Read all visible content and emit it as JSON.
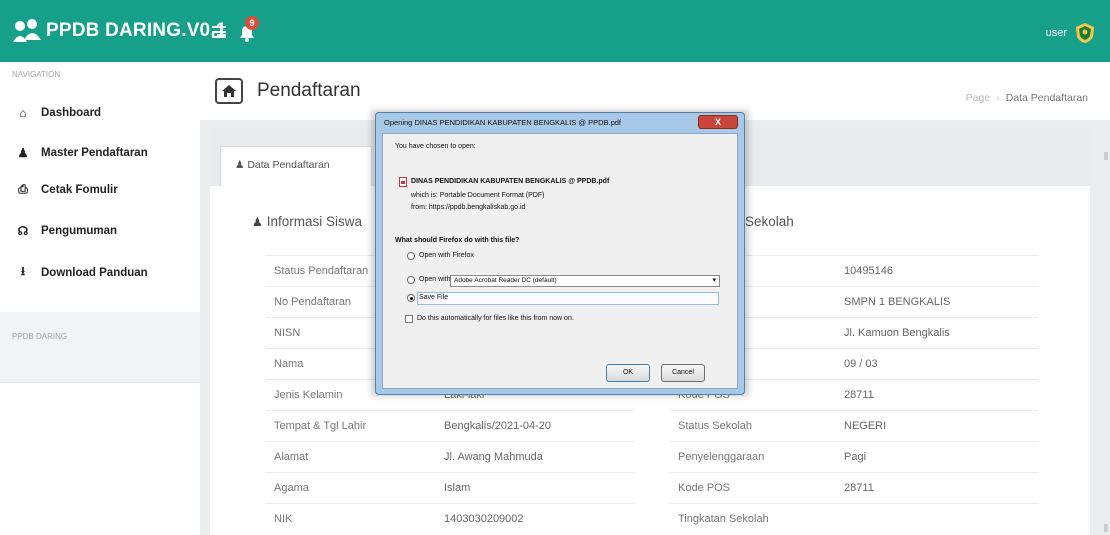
{
  "topbar": {
    "app_title": "PPDB DARING.V0.1",
    "notification_count": "9",
    "username": "user",
    "accent_color": "#16a08a"
  },
  "sidebar": {
    "nav_header": "NAVIGATION",
    "items": [
      {
        "label": "Dashboard",
        "icon": "home-icon"
      },
      {
        "label": "Master Pendaftaran",
        "icon": "user-icon"
      },
      {
        "label": "Cetak Fomulir",
        "icon": "print-icon"
      },
      {
        "label": "Pengumuman",
        "icon": "bullhorn-icon"
      },
      {
        "label": "Download Panduan",
        "icon": "download-icon"
      }
    ],
    "section_label": "PPDB DARING"
  },
  "header": {
    "title": "Pendaftaran",
    "breadcrumb": [
      "Page",
      "Data Pendaftaran"
    ]
  },
  "tabs": {
    "active": "Data Pendaftaran"
  },
  "siswa": {
    "title": "Informasi Siswa",
    "rows": [
      {
        "label": "Status Pendaftaran",
        "value": ""
      },
      {
        "label": "No Pendaftaran",
        "value": ""
      },
      {
        "label": "NISN",
        "value": ""
      },
      {
        "label": "Nama",
        "value": ""
      },
      {
        "label": "Jenis Kelamin",
        "value": "Laki-laki"
      },
      {
        "label": "Tempat & Tgl Lahir",
        "value": "Bengkalis/2021-04-20"
      },
      {
        "label": "Alamat",
        "value": "Jl. Awang Mahmuda"
      },
      {
        "label": "Agama",
        "value": "Islam"
      },
      {
        "label": "NIK",
        "value": "1403030209002"
      }
    ]
  },
  "sekolah": {
    "title": "Sekolah",
    "rows": [
      {
        "label": "",
        "value": "10495146"
      },
      {
        "label": "",
        "value": "SMPN 1 BENGKALIS"
      },
      {
        "label": "",
        "value": "Jl. Kamuon Bengkalis"
      },
      {
        "label": "",
        "value": "09 / 03"
      },
      {
        "label": "Kode POS",
        "value": "28711"
      },
      {
        "label": "Status Sekolah",
        "value": "NEGERI"
      },
      {
        "label": "Penyelenggaraan",
        "value": "Pagi"
      },
      {
        "label": "Kode POS",
        "value": "28711"
      },
      {
        "label": "Tingkatan Sekolah",
        "value": ""
      }
    ]
  },
  "dialog": {
    "title": "Opening DINAS PENDIDIKAN KABUPATEN BENGKALIS @ PPDB.pdf",
    "close_label": "X",
    "chosen_text": "You have chosen to open:",
    "file_name": "DINAS PENDIDIKAN KABUPATEN BENGKALIS @ PPDB.pdf",
    "which_is": "which is: Portable Document Format (PDF)",
    "from": "from: https://ppdb.bengkaliskab.go.id",
    "question": "What should Firefox do with this file?",
    "opt_firefox": "Open with Firefox",
    "opt_open_with": "Open with",
    "open_with_app": "Adobe Acrobat Reader DC (default)",
    "opt_save": "Save File",
    "auto_check": "Do this automatically for files like this from now on.",
    "ok_label": "OK",
    "cancel_label": "Cancel"
  }
}
